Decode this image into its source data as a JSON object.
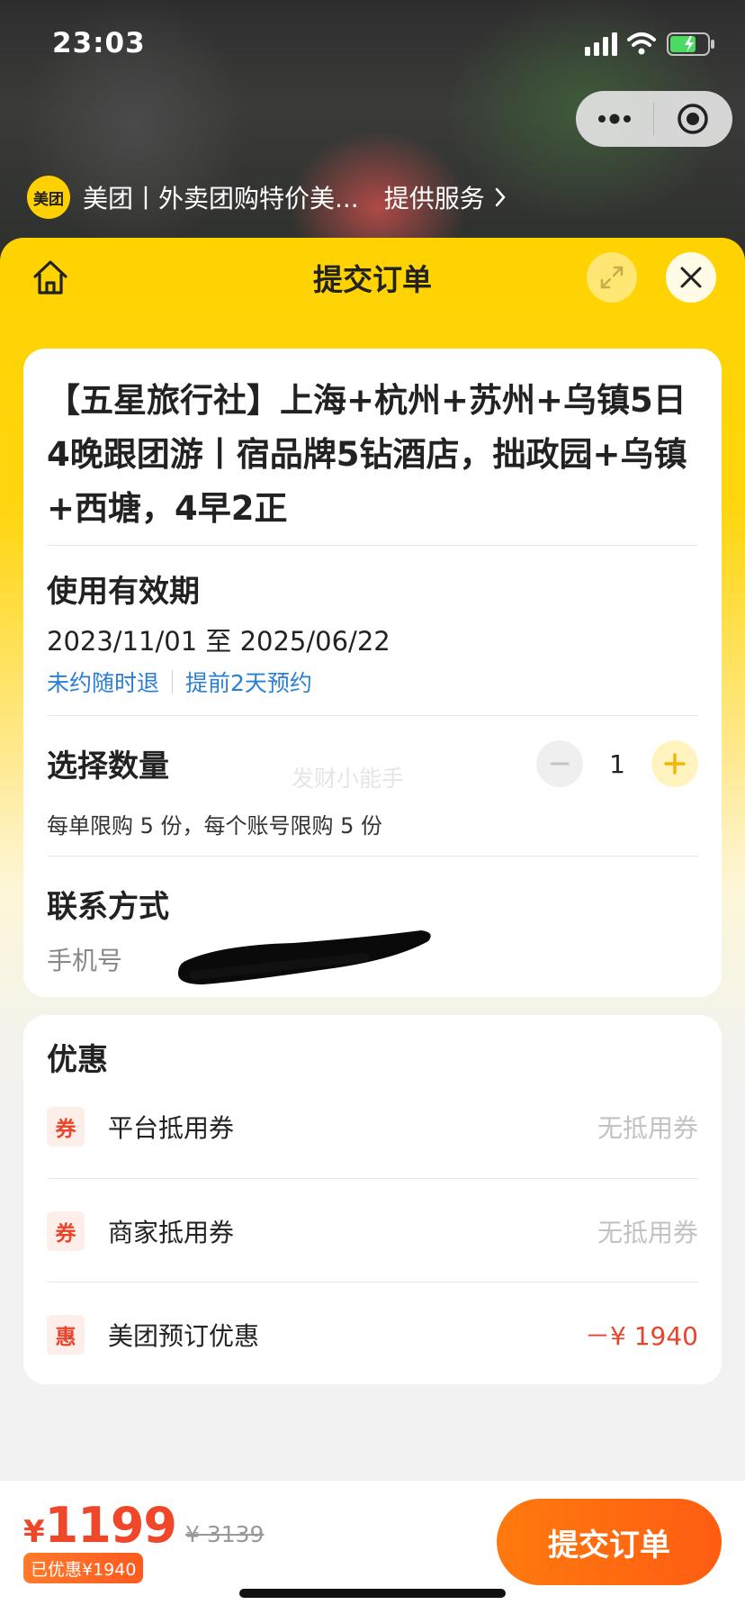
{
  "status_bar": {
    "time": "23:03"
  },
  "mini_program": {
    "logo_text": "美团",
    "name": "美团丨外卖团购特价美...",
    "service": "提供服务"
  },
  "header": {
    "title": "提交订单"
  },
  "product": {
    "title": "【五星旅行社】上海+杭州+苏州+乌镇5日4晚跟团游丨宿品牌5钻酒店，拙政园+乌镇+西塘，4早2正"
  },
  "validity": {
    "label": "使用有效期",
    "dates": "2023/11/01 至 2025/06/22",
    "policy_refund": "未约随时退",
    "policy_booking": "提前2天预约"
  },
  "quantity": {
    "label": "选择数量",
    "value": "1",
    "limit_text": "每单限购 5 份，每个账号限购 5 份",
    "watermark": "发财小能手"
  },
  "contact": {
    "label": "联系方式",
    "phone_label": "手机号"
  },
  "discounts": {
    "title": "优惠",
    "rows": [
      {
        "badge": "券",
        "label": "平台抵用券",
        "value": "无抵用券"
      },
      {
        "badge": "券",
        "label": "商家抵用券",
        "value": "无抵用券"
      },
      {
        "badge": "惠",
        "label": "美团预订优惠",
        "value": "－¥ 1940"
      }
    ]
  },
  "bottom_bar": {
    "currency": "¥",
    "price": "1199",
    "original_price": "¥ 3139",
    "saved_text": "已优惠¥1940",
    "submit_label": "提交订单"
  },
  "colors": {
    "brand_yellow": "#ffd200",
    "accent_orange": "#ff6a12",
    "price_red": "#f0462a",
    "link_blue": "#2a7fd4"
  }
}
